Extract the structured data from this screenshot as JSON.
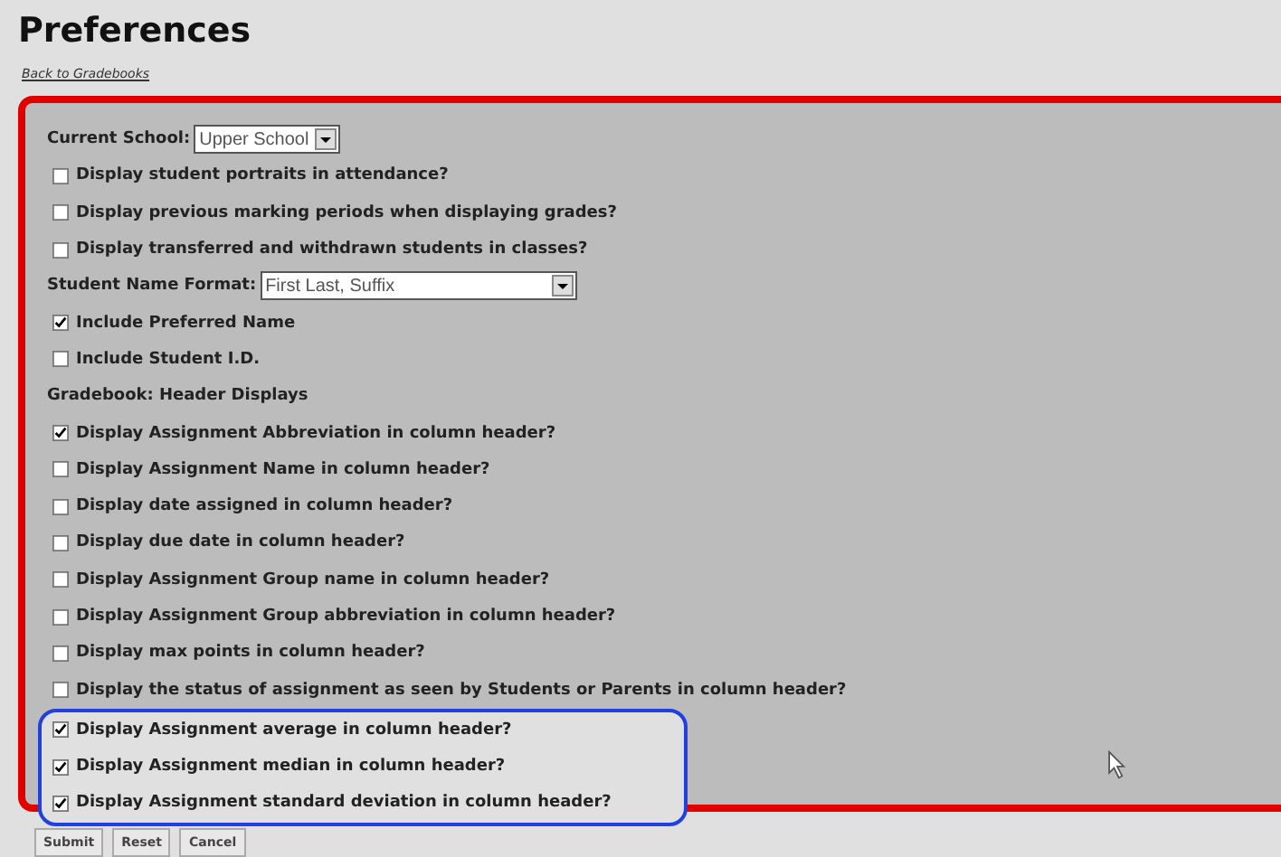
{
  "title": "Preferences",
  "back_link": "Back to Gradebooks",
  "options": [
    {
      "kind": "select",
      "label": "Current School:",
      "value": "Upper School",
      "wide": false
    },
    {
      "kind": "checkbox",
      "label": "Display student portraits in attendance?",
      "checked": false
    },
    {
      "kind": "checkbox",
      "label": "Display previous marking periods when displaying grades?",
      "checked": false
    },
    {
      "kind": "checkbox",
      "label": "Display transferred and withdrawn students in classes?",
      "checked": false
    },
    {
      "kind": "select",
      "label": "Student Name Format:",
      "value": "First Last, Suffix",
      "wide": true
    },
    {
      "kind": "checkbox",
      "label": "Include Preferred Name",
      "checked": true
    },
    {
      "kind": "checkbox",
      "label": "Include Student I.D.",
      "checked": false
    },
    {
      "kind": "heading",
      "label": "Gradebook: Header Displays"
    },
    {
      "kind": "checkbox",
      "label": "Display Assignment Abbreviation in column header?",
      "checked": true
    },
    {
      "kind": "checkbox",
      "label": "Display Assignment Name in column header?",
      "checked": false
    },
    {
      "kind": "checkbox",
      "label": "Display date assigned in column header?",
      "checked": false
    },
    {
      "kind": "checkbox",
      "label": "Display due date in column header?",
      "checked": false
    },
    {
      "kind": "checkbox",
      "label": "Display Assignment Group name in column header?",
      "checked": false
    },
    {
      "kind": "checkbox",
      "label": "Display Assignment Group abbreviation in column header?",
      "checked": false
    },
    {
      "kind": "checkbox",
      "label": "Display max points in column header?",
      "checked": false
    },
    {
      "kind": "checkbox",
      "label": "Display the status of assignment as seen by Students or Parents in column header?",
      "checked": false
    }
  ],
  "highlighted_options": [
    {
      "kind": "checkbox",
      "label": "Display Assignment average in column header?",
      "checked": true
    },
    {
      "kind": "checkbox",
      "label": "Display Assignment median in column header?",
      "checked": true
    },
    {
      "kind": "checkbox",
      "label": "Display Assignment standard deviation in column header?",
      "checked": true
    }
  ],
  "buttons": [
    "Submit",
    "Reset",
    "Cancel"
  ]
}
